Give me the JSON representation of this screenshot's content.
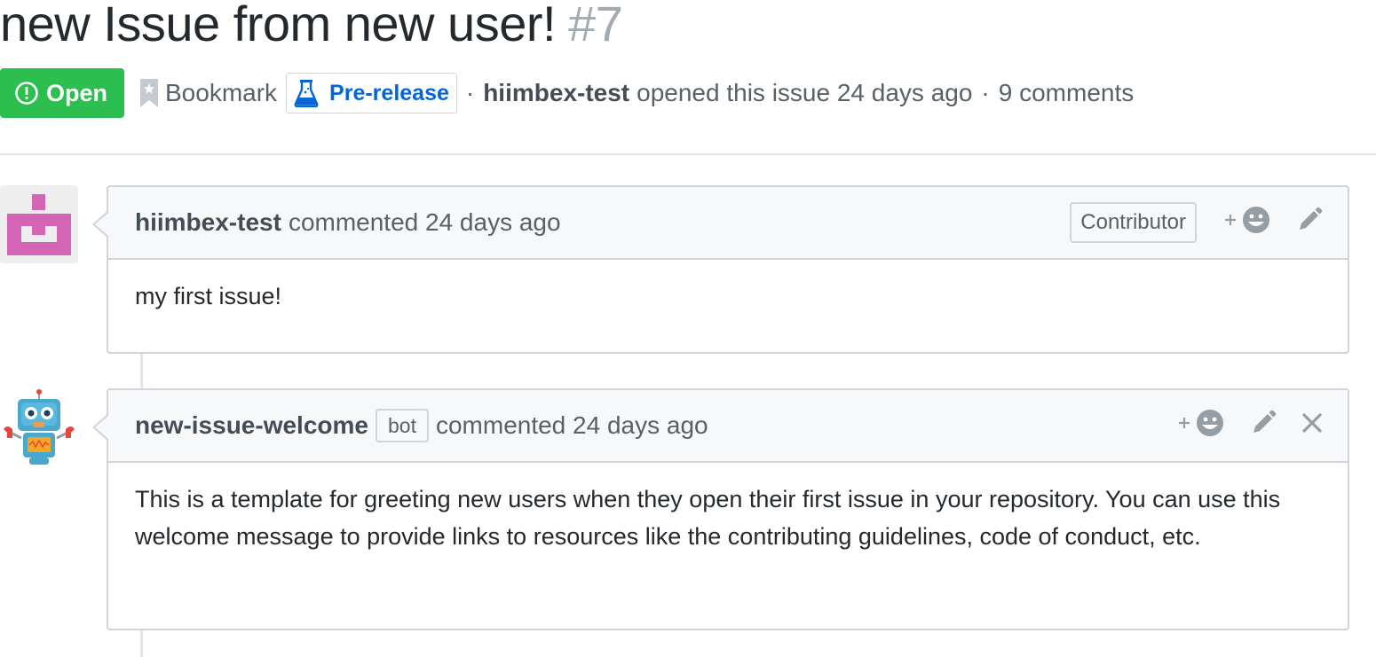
{
  "issue": {
    "title": "new Issue from new user!",
    "number": "#7",
    "state": "Open",
    "bookmark_label": "Bookmark",
    "milestone_label": "Pre-release",
    "separator": "·",
    "author": "hiimbex-test",
    "opened_text": "opened this issue 24 days ago",
    "comments_count": "9 comments"
  },
  "comments": [
    {
      "author": "hiimbex-test",
      "action_text": "commented 24 days ago",
      "role_label": "Contributor",
      "body": "my first issue!"
    },
    {
      "author": "new-issue-welcome",
      "bot_label": "bot",
      "action_text": "commented 24 days ago",
      "body": "This is a template for greeting new users when they open their first issue in your repository. You can use this welcome message to provide links to resources like the contributing guidelines, code of conduct, etc."
    }
  ],
  "icons": {
    "state": "issue-opened-icon",
    "bookmark": "bookmark-icon",
    "milestone": "beaker-icon",
    "reaction": "smiley-icon",
    "edit": "pencil-icon",
    "close": "x-icon"
  },
  "colors": {
    "open_green": "#2cbe4e",
    "link_blue": "#0366d6",
    "avatar_pink": "#d464b4",
    "muted_text": "#586069",
    "border": "#d1d5da"
  }
}
